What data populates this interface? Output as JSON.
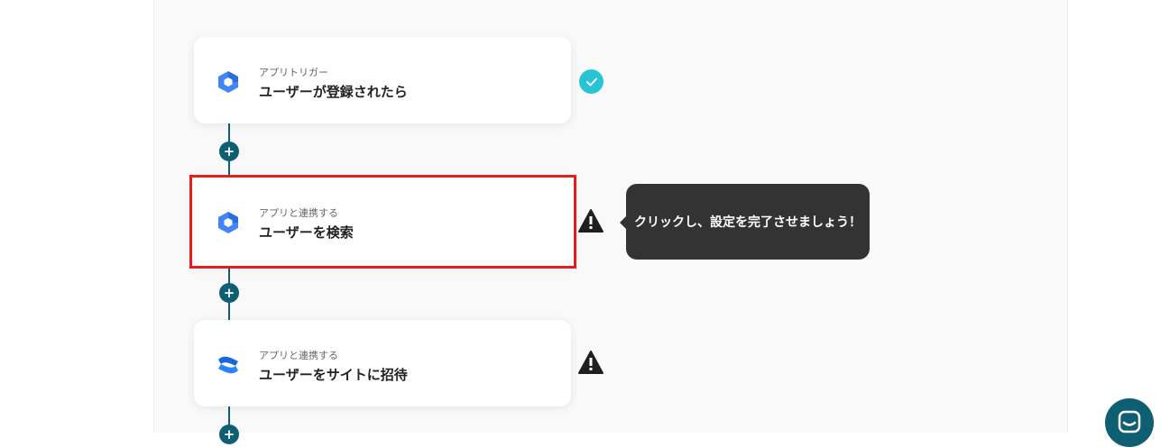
{
  "flow": {
    "steps": [
      {
        "subtitle": "アプリトリガー",
        "title": "ユーザーが登録されたら",
        "app_icon": "google-workspace-icon",
        "status": "check-icon"
      },
      {
        "subtitle": "アプリと連携する",
        "title": "ユーザーを検索",
        "app_icon": "google-workspace-icon",
        "status": "warning-icon",
        "selected": true
      },
      {
        "subtitle": "アプリと連携する",
        "title": "ユーザーをサイトに招待",
        "app_icon": "confluence-icon",
        "status": "warning-icon"
      }
    ],
    "add_step_icon": "plus-icon"
  },
  "tooltip": {
    "text": "クリックし、設定を完了させましょう！"
  },
  "colors": {
    "accent": "#0e5f72",
    "check": "#27c4d6",
    "selected_outline": "#e02020",
    "tooltip_bg": "#333333"
  },
  "chat": {
    "icon": "chat-icon"
  }
}
